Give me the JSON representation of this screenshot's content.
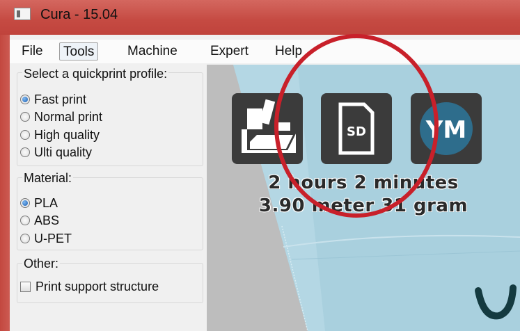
{
  "window": {
    "title": "Cura - 15.04",
    "icon": "cura-app-icon"
  },
  "menu": [
    {
      "label": "File",
      "id": "file"
    },
    {
      "label": "Tools",
      "id": "tools"
    },
    {
      "label": "Machine",
      "id": "machine"
    },
    {
      "label": "Expert",
      "id": "expert"
    },
    {
      "label": "Help",
      "id": "help"
    }
  ],
  "profile": {
    "label": "Select a quickprint profile:",
    "options": [
      "Fast print",
      "Normal print",
      "High quality",
      "Ulti quality"
    ],
    "selected": "Fast print"
  },
  "material": {
    "label": "Material:",
    "options": [
      "PLA",
      "ABS",
      "U-PET"
    ],
    "selected": "PLA"
  },
  "other": {
    "label": "Other:",
    "support_label": "Print support structure",
    "support_checked": false
  },
  "viewport": {
    "buttons": [
      {
        "icon": "save-to-disk-icon"
      },
      {
        "icon": "sd-card-icon",
        "text": "SD"
      },
      {
        "icon": "youmagine-icon",
        "text": "YM"
      }
    ],
    "print_time": "2 hours 2 minutes",
    "print_material": "3.90 meter 31 gram"
  },
  "colors": {
    "titlebar": "#c54a42",
    "annotation": "#c8202a",
    "floor": "#a9d0de",
    "button_bg": "#3b3b3b",
    "ym_circle": "#2e6d8c"
  }
}
